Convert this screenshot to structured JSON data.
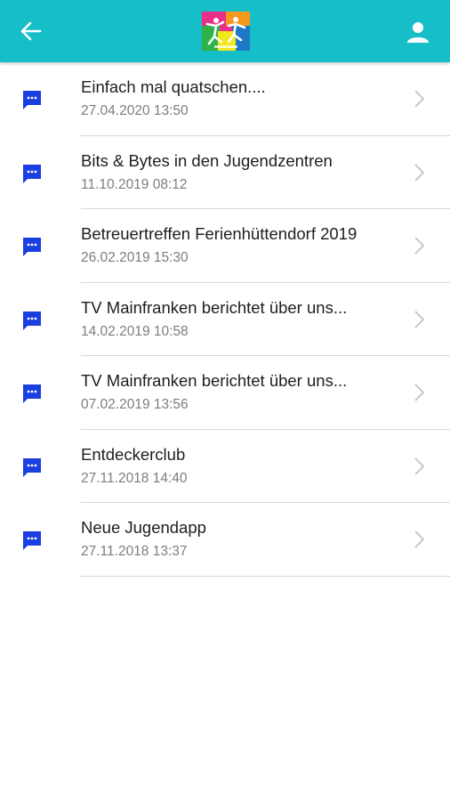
{
  "header": {
    "back_icon": "arrow-left-icon",
    "logo_icon": "app-logo",
    "profile_icon": "person-icon",
    "background": "#16bec8"
  },
  "messages": [
    {
      "title": "Einfach mal quatschen....",
      "date": "27.04.2020 13:50"
    },
    {
      "title": "Bits & Bytes in den Jugendzentren",
      "date": "11.10.2019 08:12"
    },
    {
      "title": "Betreuertreffen Ferienhüttendorf 2019",
      "date": "26.02.2019 15:30"
    },
    {
      "title": "TV Mainfranken berichtet über uns...",
      "date": "14.02.2019 10:58"
    },
    {
      "title": "TV Mainfranken berichtet über uns...",
      "date": "07.02.2019 13:56"
    },
    {
      "title": "Entdeckerclub",
      "date": "27.11.2018 14:40"
    },
    {
      "title": "Neue Jugendapp",
      "date": "27.11.2018 13:37"
    }
  ],
  "colors": {
    "accent": "#16bec8",
    "chat_icon": "#1a3ee0",
    "chevron": "#c8c8c8"
  }
}
